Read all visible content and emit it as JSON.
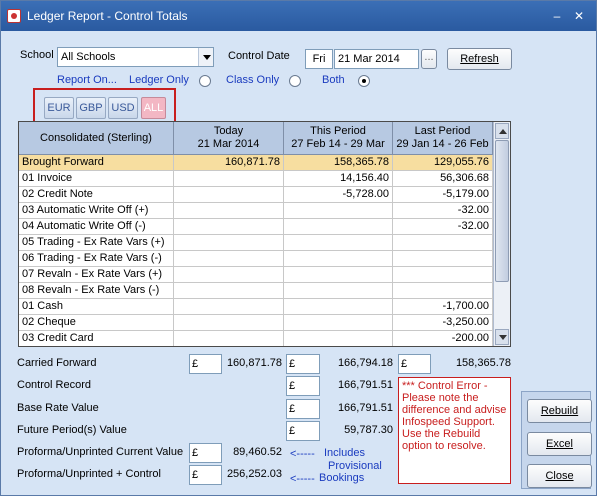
{
  "window": {
    "title": "Ledger Report - Control Totals",
    "minimize": "–",
    "close": "✕"
  },
  "filters": {
    "school_label": "School",
    "school_value": "All Schools",
    "control_date_label": "Control Date",
    "control_day": "Fri",
    "control_date": "21 Mar 2014",
    "date_picker": "...",
    "refresh_label": "Refresh",
    "report_on_label": "Report On...",
    "report_options": [
      "Ledger Only",
      "Class Only",
      "Both"
    ]
  },
  "currencies": [
    "EUR",
    "GBP",
    "USD",
    "ALL"
  ],
  "grid": {
    "headers": [
      {
        "line1": "Consolidated (Sterling)",
        "line2": ""
      },
      {
        "line1": "Today",
        "line2": "21 Mar 2014"
      },
      {
        "line1": "This Period",
        "line2": "27 Feb 14 - 29 Mar"
      },
      {
        "line1": "Last Period",
        "line2": "29 Jan 14 - 26 Feb"
      }
    ],
    "rows": [
      [
        "Brought Forward",
        "160,871.78",
        "158,365.78",
        "129,055.76"
      ],
      [
        "01 Invoice",
        "",
        "14,156.40",
        "56,306.68"
      ],
      [
        "02 Credit Note",
        "",
        "-5,728.00",
        "-5,179.00"
      ],
      [
        "03 Automatic Write Off (+)",
        "",
        "",
        "-32.00"
      ],
      [
        "04 Automatic Write Off (-)",
        "",
        "",
        "-32.00"
      ],
      [
        "05 Trading - Ex Rate Vars (+)",
        "",
        "",
        ""
      ],
      [
        "06 Trading - Ex Rate Vars (-)",
        "",
        "",
        ""
      ],
      [
        "07 Revaln - Ex Rate Vars (+)",
        "",
        "",
        ""
      ],
      [
        "08 Revaln - Ex Rate Vars (-)",
        "",
        "",
        ""
      ],
      [
        "01 Cash",
        "",
        "",
        "-1,700.00"
      ],
      [
        "02 Cheque",
        "",
        "",
        "-3,250.00"
      ],
      [
        "03 Credit Card",
        "",
        "",
        "-200.00"
      ]
    ]
  },
  "summary": {
    "currency_symbol": "£",
    "carried_forward_label": "Carried Forward",
    "carried_forward": [
      "160,871.78",
      "166,794.18",
      "158,365.78"
    ],
    "control_record_label": "Control Record",
    "control_record": "166,791.51",
    "base_rate_label": "Base Rate Value",
    "base_rate": "166,791.51",
    "future_periods_label": "Future Period(s) Value",
    "future_periods": "59,787.30",
    "proforma_current_label": "Proforma/Unprinted Current Value",
    "proforma_current": "89,460.52",
    "proforma_control_label": "Proforma/Unprinted + Control",
    "proforma_control": "256,252.03",
    "includes_arrow": "<-----",
    "includes_text": "Includes",
    "provisional_text": "Provisional",
    "bookings_arrow": "<-----",
    "bookings_text": "Bookings"
  },
  "error_message": "*** Control Error - Please note the difference and advise Infospeed Support.  Use the Rebuild option to resolve.",
  "actions": {
    "rebuild": "Rebuild",
    "excel": "Excel",
    "close": "Close"
  }
}
